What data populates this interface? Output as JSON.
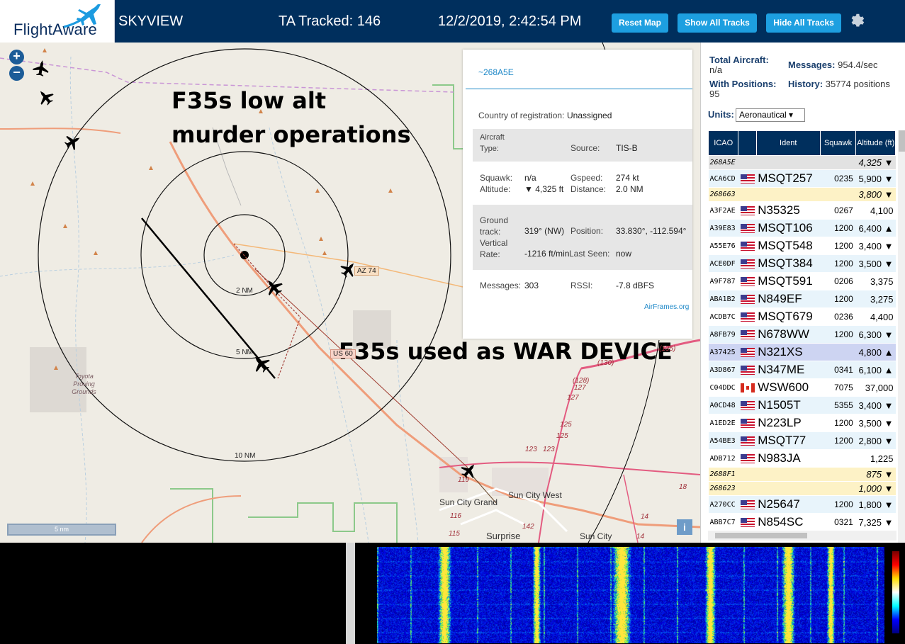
{
  "header": {
    "logo_text": "FlightAware",
    "app_name": "SKYVIEW",
    "tracked": "TA Tracked: 146",
    "datetime": "12/2/2019, 2:42:54 PM",
    "reset_label": "Reset Map",
    "show_label": "Show All Tracks",
    "hide_label": "Hide All Tracks"
  },
  "map": {
    "zoom_in": "+",
    "zoom_out": "−",
    "scale_label": "5 nm",
    "info": "i",
    "caption_top": "F35s low alt murder operations",
    "caption_bottom": "F35s used as WAR DEVICE",
    "ring_labels": [
      "2 NM",
      "5 NM",
      "10 NM"
    ],
    "road_labels": [
      "AZ 74",
      "US 60"
    ],
    "route_numbers": [
      "(135)",
      "(130)",
      "(128)",
      "127",
      "127",
      "125",
      "125",
      "123",
      "123",
      "119",
      "116",
      "115",
      "142",
      "18",
      "14",
      "14"
    ],
    "towns": [
      "Sun City West",
      "Sun City Grand",
      "Surprise",
      "Sun City"
    ],
    "area_label": "Toyota Proving Grounds"
  },
  "popup": {
    "hex": "~268A5E",
    "country_label": "Country of registration:",
    "country_value": "Unassigned",
    "aircraft_type_label": "Aircraft Type:",
    "aircraft_type_value": "",
    "source_label": "Source:",
    "source_value": "TIS-B",
    "squawk_label": "Squawk:",
    "squawk_value": "n/a",
    "gspeed_label": "Gspeed:",
    "gspeed_value": "274 kt",
    "altitude_label": "Altitude:",
    "altitude_value": "▼ 4,325 ft",
    "distance_label": "Distance:",
    "distance_value": "2.0 NM",
    "ground_track_label": "Ground track:",
    "ground_track_value": "319° (NW)",
    "position_label": "Position:",
    "position_value": "33.830°, -112.594°",
    "vert_rate_label": "Vertical Rate:",
    "vert_rate_value": "-1216 ft/min",
    "last_seen_label": "Last Seen:",
    "last_seen_value": "now",
    "messages_label": "Messages:",
    "messages_value": "303",
    "rssi_label": "RSSI:",
    "rssi_value": "-7.8 dBFS",
    "link": "AirFrames.org"
  },
  "panel": {
    "total_aircraft_label": "Total Aircraft:",
    "total_aircraft_value": "n/a",
    "messages_label": "Messages:",
    "messages_value": "954.4/sec",
    "with_positions_label": "With Positions:",
    "with_positions_value": "95",
    "history_label": "History:",
    "history_value": "35774 positions",
    "units_label": "Units:",
    "units_value": "Aeronautical ▾",
    "columns": [
      "ICAO",
      "",
      "Ident",
      "Squawk",
      "Altitude (ft)"
    ],
    "rows": [
      {
        "icao": "268A5E",
        "flag": "",
        "ident": "",
        "squawk": "",
        "alt": "4,325 ▼",
        "style": "gray"
      },
      {
        "icao": "ACA6CD",
        "flag": "us",
        "ident": "MSQT257",
        "squawk": "0235",
        "alt": "5,900 ▼",
        "style": ""
      },
      {
        "icao": "268663",
        "flag": "",
        "ident": "",
        "squawk": "",
        "alt": "3,800 ▼",
        "style": "yel"
      },
      {
        "icao": "A3F2AE",
        "flag": "us",
        "ident": "N35325",
        "squawk": "0267",
        "alt": "4,100",
        "style": "alt"
      },
      {
        "icao": "A39E83",
        "flag": "us",
        "ident": "MSQT106",
        "squawk": "1200",
        "alt": "6,400 ▲",
        "style": ""
      },
      {
        "icao": "A55E76",
        "flag": "us",
        "ident": "MSQT548",
        "squawk": "1200",
        "alt": "3,400 ▼",
        "style": "alt"
      },
      {
        "icao": "ACE0DF",
        "flag": "us",
        "ident": "MSQT384",
        "squawk": "1200",
        "alt": "3,500 ▼",
        "style": ""
      },
      {
        "icao": "A9F787",
        "flag": "us",
        "ident": "MSQT591",
        "squawk": "0206",
        "alt": "3,375",
        "style": "alt"
      },
      {
        "icao": "ABA1B2",
        "flag": "us",
        "ident": "N849EF",
        "squawk": "1200",
        "alt": "3,275",
        "style": ""
      },
      {
        "icao": "ACDB7C",
        "flag": "us",
        "ident": "MSQT679",
        "squawk": "0236",
        "alt": "4,400",
        "style": "alt"
      },
      {
        "icao": "A8FB79",
        "flag": "us",
        "ident": "N678WW",
        "squawk": "1200",
        "alt": "6,300 ▼",
        "style": ""
      },
      {
        "icao": "A37425",
        "flag": "us",
        "ident": "N321XS",
        "squawk": "",
        "alt": "4,800 ▲",
        "style": "sel"
      },
      {
        "icao": "A3D867",
        "flag": "us",
        "ident": "N347ME",
        "squawk": "0341",
        "alt": "6,100 ▲",
        "style": ""
      },
      {
        "icao": "C04DDC",
        "flag": "ca",
        "ident": "WSW600",
        "squawk": "7075",
        "alt": "37,000",
        "style": "alt"
      },
      {
        "icao": "A0CD48",
        "flag": "us",
        "ident": "N1505T",
        "squawk": "5355",
        "alt": "3,400 ▼",
        "style": ""
      },
      {
        "icao": "A1ED2E",
        "flag": "us",
        "ident": "N223LP",
        "squawk": "1200",
        "alt": "3,500 ▼",
        "style": "alt"
      },
      {
        "icao": "A54BE3",
        "flag": "us",
        "ident": "MSQT77",
        "squawk": "1200",
        "alt": "2,800 ▼",
        "style": ""
      },
      {
        "icao": "ADB712",
        "flag": "us",
        "ident": "N983JA",
        "squawk": "",
        "alt": "1,225",
        "style": "alt"
      },
      {
        "icao": "2688F1",
        "flag": "",
        "ident": "",
        "squawk": "",
        "alt": "875 ▼",
        "style": "yel"
      },
      {
        "icao": "268623",
        "flag": "",
        "ident": "",
        "squawk": "",
        "alt": "1,000 ▼",
        "style": "yel"
      },
      {
        "icao": "A270CC",
        "flag": "us",
        "ident": "N25647",
        "squawk": "1200",
        "alt": "1,800 ▼",
        "style": ""
      },
      {
        "icao": "ABB7C7",
        "flag": "us",
        "ident": "N854SC",
        "squawk": "0321",
        "alt": "7,325 ▼",
        "style": "alt"
      }
    ]
  },
  "colors": {
    "header_bg": "#002f5d",
    "button_bg": "#1d9fe0",
    "link": "#1e88c8",
    "selected_row": "#cdd4f2",
    "tisb_row": "#fdf2c6"
  },
  "icons": [
    "zoom-in-icon",
    "zoom-out-icon",
    "gear-icon",
    "plane-icon",
    "airplane-logo-icon",
    "info-icon"
  ]
}
